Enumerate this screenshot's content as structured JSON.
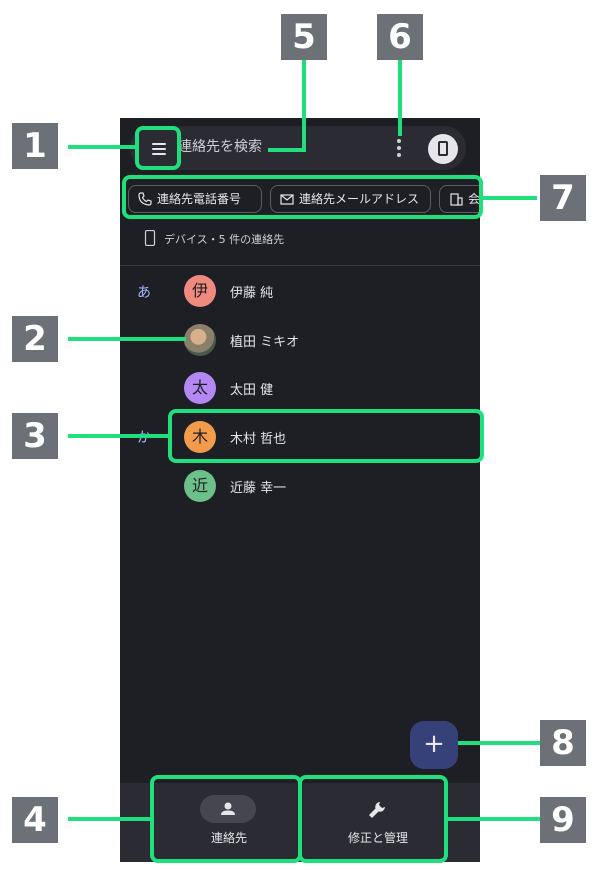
{
  "search": {
    "placeholder": "連絡先を検索"
  },
  "filter_chips": [
    {
      "label": "連絡先電話番号",
      "icon": "phone-icon"
    },
    {
      "label": "連絡先メールアドレス",
      "icon": "mail-icon"
    },
    {
      "label": "会",
      "icon": "building-icon"
    }
  ],
  "device_info": "デバイス・5 件の連絡先",
  "sections": [
    {
      "letter": "あ"
    },
    {
      "letter": "か"
    }
  ],
  "contacts": [
    {
      "initial": "伊",
      "name": "伊藤 純",
      "color": "#f08a7e"
    },
    {
      "initial": "",
      "name": "植田 ミキオ",
      "color": "#8a7f6a"
    },
    {
      "initial": "太",
      "name": "太田 健",
      "color": "#b388f2"
    },
    {
      "initial": "木",
      "name": "木村 哲也",
      "color": "#f29b4c"
    },
    {
      "initial": "近",
      "name": "近藤 幸一",
      "color": "#6cc08a"
    }
  ],
  "fab": {
    "label": "+"
  },
  "bottom_nav": [
    {
      "label": "連絡先",
      "icon": "person-icon"
    },
    {
      "label": "修正と管理",
      "icon": "wrench-icon"
    }
  ],
  "callouts": [
    "1",
    "2",
    "3",
    "4",
    "5",
    "6",
    "7",
    "8",
    "9"
  ],
  "colors": {
    "accent": "#1fe07d",
    "badge": "#6b7176",
    "background": "#1e1f24"
  }
}
